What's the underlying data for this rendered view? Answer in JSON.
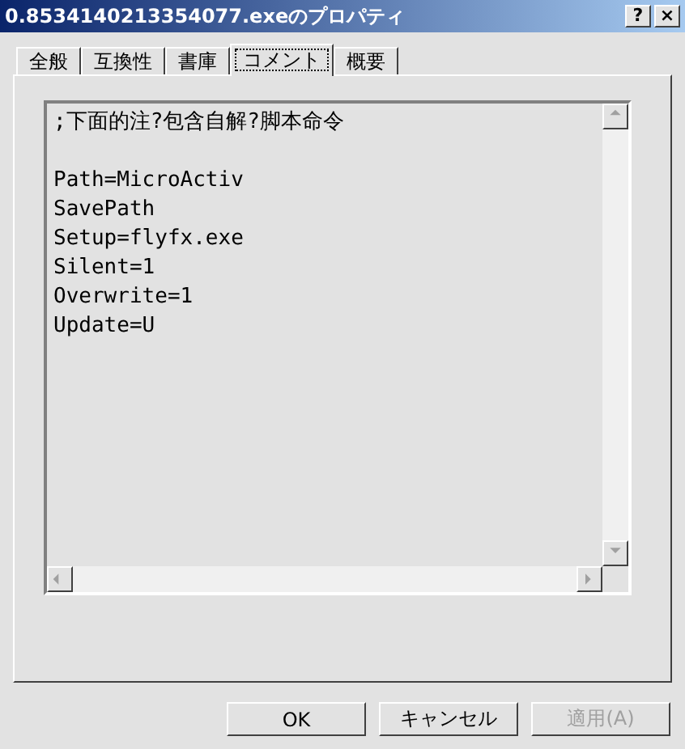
{
  "window": {
    "title": "0.8534140213354077.exeのプロパティ",
    "help_button": "?",
    "close_button": "×"
  },
  "tabs": [
    {
      "label": "全般",
      "selected": false
    },
    {
      "label": "互換性",
      "selected": false
    },
    {
      "label": "書庫",
      "selected": false
    },
    {
      "label": "コメント",
      "selected": true
    },
    {
      "label": "概要",
      "selected": false
    }
  ],
  "comment": {
    "paragraphs": [
      [
        ";下面的注?包含自解?脚本命令"
      ],
      [
        "Path=MicroActiv",
        "SavePath",
        "Setup=flyfx.exe",
        "Silent=1",
        "Overwrite=1",
        "Update=U"
      ]
    ]
  },
  "buttons": [
    {
      "label": "OK",
      "disabled": false
    },
    {
      "label": "キャンセル",
      "disabled": false
    },
    {
      "label": "適用(A)",
      "disabled": true
    }
  ]
}
